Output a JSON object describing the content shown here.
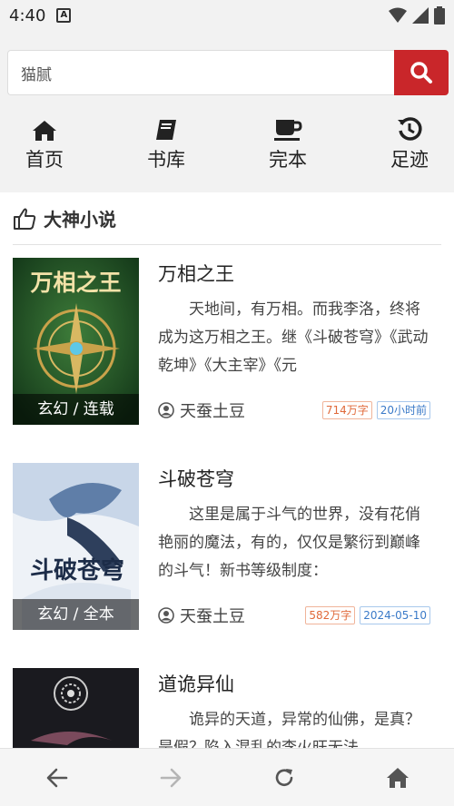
{
  "status": {
    "time": "4:40",
    "notif_letter": "A"
  },
  "search": {
    "value": "猫腻"
  },
  "nav": [
    {
      "label": "首页",
      "icon": "home-icon"
    },
    {
      "label": "书库",
      "icon": "book-icon"
    },
    {
      "label": "完本",
      "icon": "coffee-cup-icon"
    },
    {
      "label": "足迹",
      "icon": "history-icon"
    }
  ],
  "section": {
    "title": "大神小说",
    "icon": "thumbs-up-icon"
  },
  "books": [
    {
      "name": "万相之王",
      "desc": "天地间，有万相。而我李洛，终将成为这万相之王。继《斗破苍穹》《武动乾坤》《大主宰》《元",
      "tag": "玄幻 / 连载",
      "author": "天蚕土豆",
      "words": "714万字",
      "updated": "20小时前",
      "cover_title": "万相之王"
    },
    {
      "name": "斗破苍穹",
      "desc": "这里是属于斗气的世界，没有花俏艳丽的魔法，有的，仅仅是繁衍到巅峰的斗气！新书等级制度：",
      "tag": "玄幻 / 全本",
      "author": "天蚕土豆",
      "words": "582万字",
      "updated": "2024-05-10",
      "cover_title": "斗破苍穹"
    },
    {
      "name": "道诡异仙",
      "desc": "诡异的天道，异常的仙佛，是真？是假？陷入混乱的李火旺无法",
      "tag": "",
      "author": "",
      "words": "",
      "updated": "",
      "cover_title": ""
    }
  ],
  "colors": {
    "accent": "#c9262a",
    "words_badge": "#e0693a",
    "time_badge": "#3a7ac8"
  }
}
